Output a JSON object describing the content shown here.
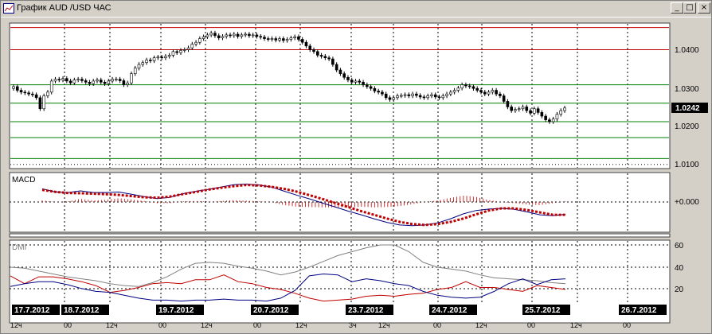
{
  "window": {
    "title": "График AUD /USD  ЧАС",
    "buttons": {
      "minimize": "_",
      "restore": "□",
      "close": "×"
    }
  },
  "price_panel": {
    "axis_labels": [
      "1.0400",
      "1.0300",
      "1.0200",
      "1.0100"
    ],
    "current_price": "1.0242"
  },
  "macd_panel": {
    "title": "MACD",
    "axis_label": "+0.000"
  },
  "dmi_panel": {
    "title": "DMI",
    "axis_labels": [
      "60",
      "40",
      "20"
    ]
  },
  "time_axis": {
    "dates": [
      "17.7.2012",
      "18.7.2012",
      "19.7.2012",
      "20.7.2012",
      "23.7.2012",
      "24.7.2012",
      "25.7.2012",
      "26.7.2012"
    ],
    "hours": [
      "12ч",
      "00",
      "12ч",
      "00",
      "12ч",
      "00",
      "12ч",
      "3ч",
      "12ч",
      "00",
      "12ч",
      "00",
      "12ч",
      "00"
    ]
  },
  "colors": {
    "background": "#ffffff",
    "frame": "#d4d0c8",
    "candles": "#000000",
    "price_redline": "#c00000",
    "price_greenline": "#008000",
    "macd_line": "#000080",
    "macd_signal": "#c00000",
    "dmi_plus": "#000080",
    "dmi_minus": "#c00000",
    "adx": "#808080"
  },
  "chart_data": [
    {
      "type": "candlestick",
      "title": "",
      "ylim": [
        1.008,
        1.047
      ],
      "y_ticks": [
        1.01,
        1.02,
        1.03,
        1.04
      ],
      "horizontal_lines": {
        "red": [
          1.04,
          1.046
        ],
        "green": [
          1.0305,
          1.0255,
          1.0205,
          1.0162,
          1.0105
        ]
      },
      "last_price": 1.0242,
      "close": [
        1.03,
        1.029,
        1.0285,
        1.0283,
        1.028,
        1.0278,
        1.027,
        1.024,
        1.0275,
        1.0285,
        1.0315,
        1.032,
        1.0318,
        1.0322,
        1.0315,
        1.031,
        1.0318,
        1.032,
        1.0316,
        1.0312,
        1.0308,
        1.0315,
        1.0318,
        1.0312,
        1.0308,
        1.0315,
        1.032,
        1.032,
        1.0316,
        1.0305,
        1.031,
        1.0335,
        1.035,
        1.036,
        1.0365,
        1.0372,
        1.037,
        1.0378,
        1.038,
        1.0378,
        1.0382,
        1.0385,
        1.0395,
        1.0392,
        1.0398,
        1.04,
        1.0405,
        1.0415,
        1.042,
        1.043,
        1.0435,
        1.044,
        1.0445,
        1.0438,
        1.0432,
        1.0436,
        1.044,
        1.0438,
        1.0442,
        1.0436,
        1.044,
        1.0442,
        1.0438,
        1.044,
        1.0436,
        1.0434,
        1.043,
        1.0428,
        1.043,
        1.0426,
        1.043,
        1.0425,
        1.0428,
        1.0432,
        1.0435,
        1.0428,
        1.042,
        1.041,
        1.04,
        1.0395,
        1.0385,
        1.0382,
        1.0378,
        1.0375,
        1.036,
        1.0345,
        1.0335,
        1.0325,
        1.0318,
        1.0312,
        1.0315,
        1.0312,
        1.0305,
        1.03,
        1.0295,
        1.0288,
        1.0285,
        1.028,
        1.027,
        1.0265,
        1.027,
        1.0275,
        1.0276,
        1.0278,
        1.0275,
        1.028,
        1.0276,
        1.0272,
        1.027,
        1.0275,
        1.0278,
        1.0272,
        1.027,
        1.0275,
        1.028,
        1.0285,
        1.029,
        1.0296,
        1.0305,
        1.0302,
        1.03,
        1.0295,
        1.029,
        1.0285,
        1.028,
        1.0285,
        1.029,
        1.028,
        1.0275,
        1.026,
        1.0245,
        1.0235,
        1.0238,
        1.024,
        1.0245,
        1.0235,
        1.0228,
        1.024,
        1.023,
        1.022,
        1.021,
        1.0205,
        1.0212,
        1.0225,
        1.0235,
        1.0242
      ]
    },
    {
      "type": "line",
      "title": "MACD",
      "ylim": [
        -1,
        1
      ],
      "zero_line": 0,
      "series": [
        {
          "values": [
            0.56,
            0.43,
            0.4,
            0.47,
            0.4,
            0.4,
            0.42,
            0.33,
            0.23,
            0.14,
            0.19,
            0.35,
            0.45,
            0.53,
            0.63,
            0.73,
            0.76,
            0.72,
            0.63,
            0.45,
            0.28,
            0.12,
            -0.05,
            -0.22,
            -0.39,
            -0.54,
            -0.71,
            -0.86,
            -0.97,
            -1.0,
            -0.97,
            -0.88,
            -0.71,
            -0.5,
            -0.36,
            -0.3,
            -0.27,
            -0.31,
            -0.42,
            -0.54,
            -0.58,
            -0.52
          ]
        },
        {
          "values": [
            0.51,
            0.43,
            0.38,
            0.37,
            0.35,
            0.33,
            0.3,
            0.25,
            0.2,
            0.18,
            0.23,
            0.33,
            0.42,
            0.52,
            0.6,
            0.67,
            0.72,
            0.7,
            0.64,
            0.55,
            0.43,
            0.28,
            0.12,
            -0.05,
            -0.22,
            -0.39,
            -0.54,
            -0.7,
            -0.84,
            -0.93,
            -0.97,
            -0.93,
            -0.84,
            -0.7,
            -0.52,
            -0.36,
            -0.27,
            -0.27,
            -0.34,
            -0.44,
            -0.54,
            -0.54
          ]
        }
      ]
    },
    {
      "type": "line",
      "title": "DMI",
      "ylim": [
        0,
        65
      ],
      "y_ticks": [
        20,
        40,
        60
      ],
      "series": [
        {
          "values": [
            17,
            20,
            22,
            22,
            19,
            15,
            12,
            11,
            8,
            5,
            3,
            3,
            2,
            3,
            3,
            4,
            3,
            3,
            2,
            5,
            13,
            28,
            30,
            29,
            22,
            25,
            23,
            20,
            18,
            12,
            8,
            6,
            5,
            6,
            12,
            20,
            25,
            19,
            24,
            25
          ]
        },
        {
          "values": [
            28,
            20,
            27,
            27,
            25,
            22,
            18,
            11,
            13,
            16,
            20,
            21,
            20,
            24,
            24,
            29,
            22,
            20,
            16,
            14,
            10,
            5,
            2,
            3,
            4,
            7,
            8,
            7,
            9,
            10,
            14,
            16,
            22,
            16,
            16,
            14,
            12,
            18,
            16,
            14
          ]
        },
        {
          "values": [
            37,
            36,
            33,
            30,
            27,
            25,
            23,
            20,
            18,
            17,
            21,
            27,
            35,
            41,
            42,
            41,
            38,
            36,
            33,
            29,
            32,
            37,
            43,
            49,
            53,
            57,
            60,
            60,
            53,
            42,
            37,
            35,
            33,
            29,
            26,
            25,
            24,
            23,
            21,
            20
          ]
        }
      ]
    }
  ]
}
